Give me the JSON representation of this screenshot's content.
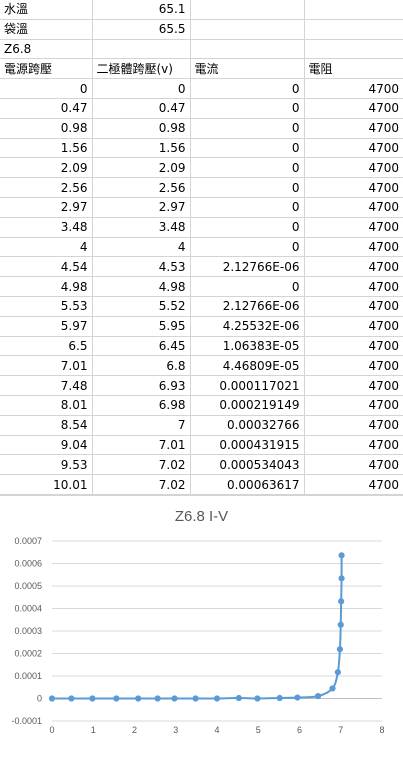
{
  "sheet": {
    "info_rows": [
      {
        "label": "水溫",
        "value": "65.1"
      },
      {
        "label": "袋溫",
        "value": "65.5"
      },
      {
        "label": "Z6.8",
        "value": ""
      }
    ],
    "headers": [
      "電源跨壓",
      "二極體跨壓(v)",
      "電流",
      "電阻"
    ],
    "rows": [
      [
        "0",
        "0",
        "0",
        "4700"
      ],
      [
        "0.47",
        "0.47",
        "0",
        "4700"
      ],
      [
        "0.98",
        "0.98",
        "0",
        "4700"
      ],
      [
        "1.56",
        "1.56",
        "0",
        "4700"
      ],
      [
        "2.09",
        "2.09",
        "0",
        "4700"
      ],
      [
        "2.56",
        "2.56",
        "0",
        "4700"
      ],
      [
        "2.97",
        "2.97",
        "0",
        "4700"
      ],
      [
        "3.48",
        "3.48",
        "0",
        "4700"
      ],
      [
        "4",
        "4",
        "0",
        "4700"
      ],
      [
        "4.54",
        "4.53",
        "2.12766E-06",
        "4700"
      ],
      [
        "4.98",
        "4.98",
        "0",
        "4700"
      ],
      [
        "5.53",
        "5.52",
        "2.12766E-06",
        "4700"
      ],
      [
        "5.97",
        "5.95",
        "4.25532E-06",
        "4700"
      ],
      [
        "6.5",
        "6.45",
        "1.06383E-05",
        "4700"
      ],
      [
        "7.01",
        "6.8",
        "4.46809E-05",
        "4700"
      ],
      [
        "7.48",
        "6.93",
        "0.000117021",
        "4700"
      ],
      [
        "8.01",
        "6.98",
        "0.000219149",
        "4700"
      ],
      [
        "8.54",
        "7",
        "0.00032766",
        "4700"
      ],
      [
        "9.04",
        "7.01",
        "0.000431915",
        "4700"
      ],
      [
        "9.53",
        "7.02",
        "0.000534043",
        "4700"
      ],
      [
        "10.01",
        "7.02",
        "0.00063617",
        "4700"
      ]
    ]
  },
  "chart_data": {
    "type": "scatter",
    "title": "Z6.8 I-V",
    "x": [
      0,
      0.47,
      0.98,
      1.56,
      2.09,
      2.56,
      2.97,
      3.48,
      4,
      4.53,
      4.98,
      5.52,
      5.95,
      6.45,
      6.8,
      6.93,
      6.98,
      7,
      7.01,
      7.02,
      7.02
    ],
    "y": [
      0,
      0,
      0,
      0,
      0,
      0,
      0,
      0,
      0,
      2.12766e-06,
      0,
      2.12766e-06,
      4.25532e-06,
      1.06383e-05,
      4.46809e-05,
      0.000117021,
      0.000219149,
      0.00032766,
      0.000431915,
      0.000534043,
      0.00063617
    ],
    "xlim": [
      0,
      8
    ],
    "ylim": [
      -0.0001,
      0.0007
    ],
    "x_ticks": [
      "0",
      "1",
      "2",
      "3",
      "4",
      "5",
      "6",
      "7",
      "8"
    ],
    "y_ticks": [
      "-0.0001",
      "0",
      "0.0001",
      "0.0002",
      "0.0003",
      "0.0004",
      "0.0005",
      "0.0006",
      "0.0007"
    ],
    "line_smooth": true,
    "grid": "horizontal",
    "legend": "none",
    "color": "#5b9bd5"
  }
}
